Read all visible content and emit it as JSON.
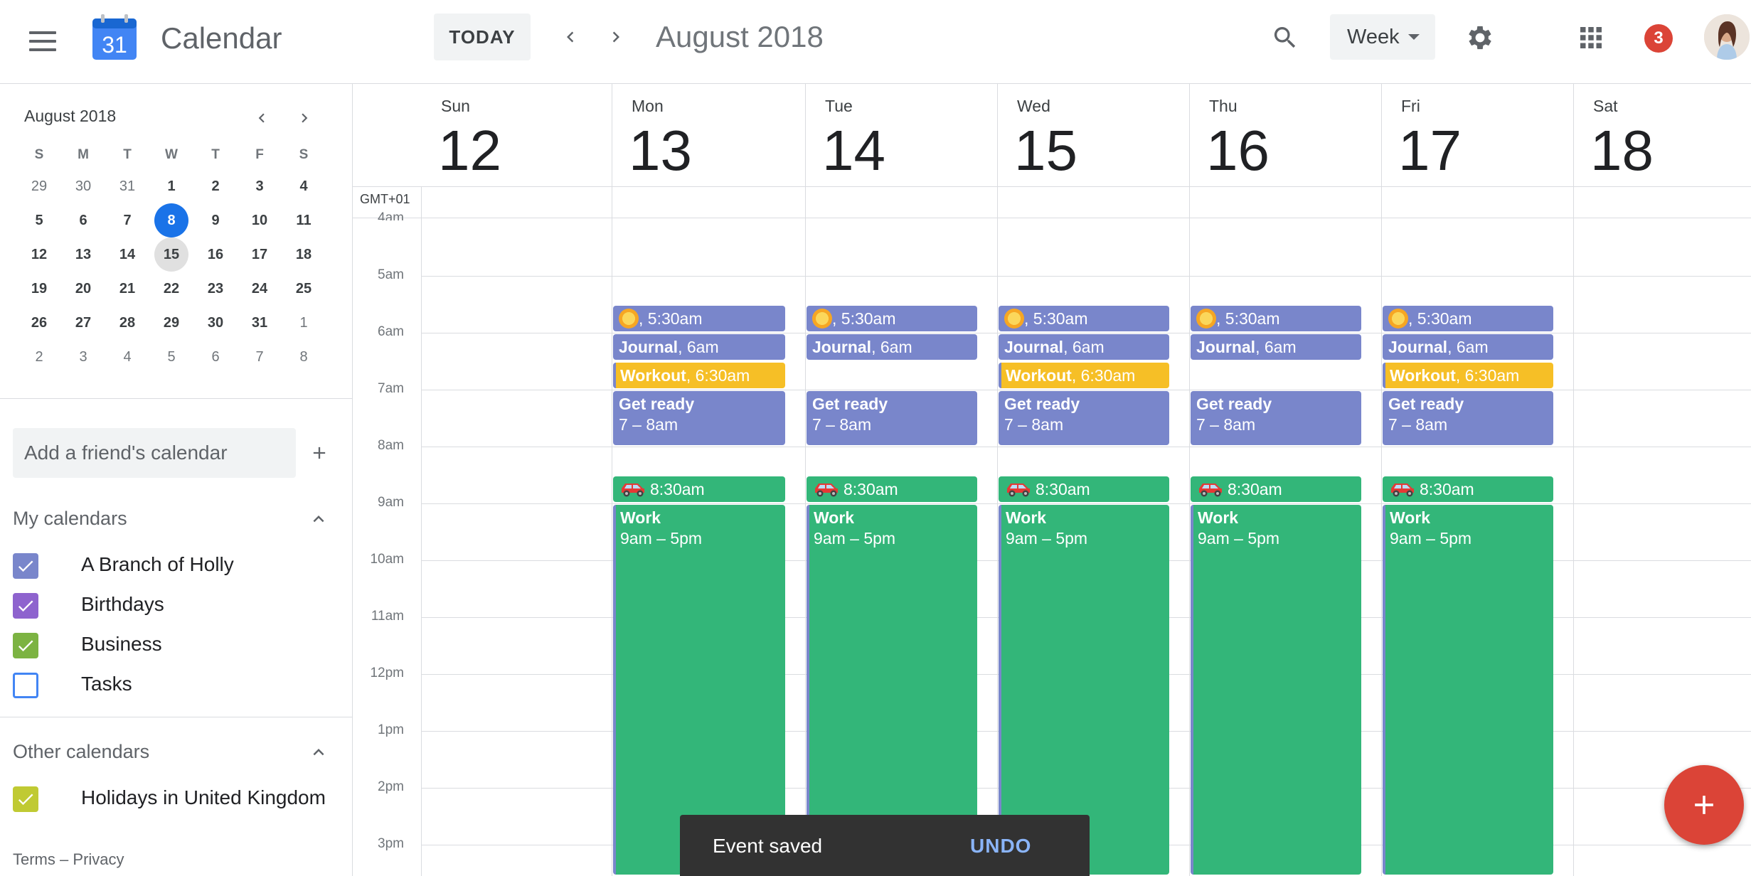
{
  "app": {
    "title": "Calendar",
    "logo_number": "31",
    "today_label": "TODAY",
    "period_title": "August 2018",
    "view_label": "Week",
    "notifications": "3"
  },
  "mini_calendar": {
    "title": "August 2018",
    "weekday_initials": [
      "S",
      "M",
      "T",
      "W",
      "T",
      "F",
      "S"
    ],
    "weeks": [
      [
        "29",
        "30",
        "31",
        "1",
        "2",
        "3",
        "4"
      ],
      [
        "5",
        "6",
        "7",
        "8",
        "9",
        "10",
        "11"
      ],
      [
        "12",
        "13",
        "14",
        "15",
        "16",
        "17",
        "18"
      ],
      [
        "19",
        "20",
        "21",
        "22",
        "23",
        "24",
        "25"
      ],
      [
        "26",
        "27",
        "28",
        "29",
        "30",
        "31",
        "1"
      ],
      [
        "2",
        "3",
        "4",
        "5",
        "6",
        "7",
        "8"
      ]
    ],
    "selected_day": "8",
    "current_day": "15"
  },
  "sidebar": {
    "friend_placeholder": "Add a friend's calendar",
    "my_calendars_title": "My calendars",
    "my_calendars": [
      {
        "label": "A Branch of Holly",
        "color": "#7986cb",
        "checked": true
      },
      {
        "label": "Birthdays",
        "color": "#8e63ce",
        "checked": true
      },
      {
        "label": "Business",
        "color": "#7cb342",
        "checked": true
      },
      {
        "label": "Tasks",
        "color": "#4285f4",
        "checked": false
      }
    ],
    "other_calendars_title": "Other calendars",
    "other_calendars": [
      {
        "label": "Holidays in United Kingdom",
        "color": "#c0ca33",
        "checked": true
      }
    ],
    "footer_terms": "Terms",
    "footer_dash": "–",
    "footer_privacy": "Privacy"
  },
  "week": {
    "timezone": "GMT+01",
    "days": [
      {
        "name": "Sun",
        "num": "12"
      },
      {
        "name": "Mon",
        "num": "13"
      },
      {
        "name": "Tue",
        "num": "14"
      },
      {
        "name": "Wed",
        "num": "15"
      },
      {
        "name": "Thu",
        "num": "16"
      },
      {
        "name": "Fri",
        "num": "17"
      },
      {
        "name": "Sat",
        "num": "18"
      }
    ],
    "time_labels": [
      "4am",
      "5am",
      "6am",
      "7am",
      "8am",
      "9am",
      "10am",
      "11am",
      "12pm",
      "1pm",
      "2pm",
      "3pm"
    ]
  },
  "events": {
    "sunrise": ", 5:30am",
    "journal_title": "Journal",
    "journal_time": ", 6am",
    "workout_title": "Workout",
    "workout_time": ", 6:30am",
    "getready_title": "Get ready",
    "getready_time": "7 – 8am",
    "commute": "8:30am",
    "work_title": "Work",
    "work_time": "9am – 5pm",
    "colors": {
      "lavender": "#7986cb",
      "banana": "#f6bf26",
      "basil": "#33b679"
    }
  },
  "snackbar": {
    "message": "Event saved",
    "action": "UNDO"
  },
  "icons": [
    "menu-icon",
    "calendar-logo-icon",
    "chevron-left-icon",
    "chevron-right-icon",
    "search-icon",
    "dropdown-caret-icon",
    "gear-icon",
    "apps-grid-icon",
    "avatar",
    "plus-icon",
    "chevron-up-icon",
    "check-icon",
    "sun-emoji-icon",
    "car-emoji-icon"
  ]
}
